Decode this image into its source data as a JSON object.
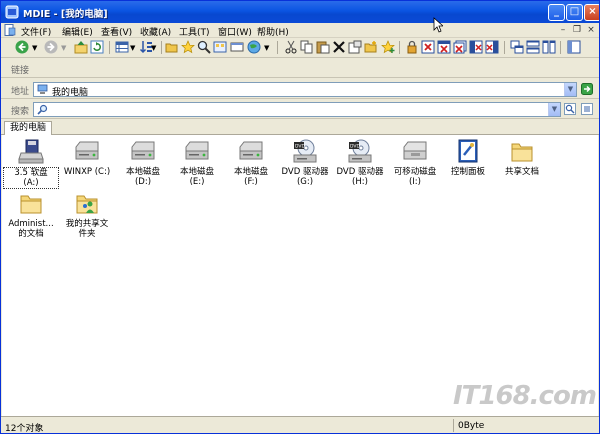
{
  "window": {
    "title": "MDIE - [我的电脑]"
  },
  "menubar": {
    "items": [
      "文件(F)",
      "编辑(E)",
      "查看(V)",
      "收藏(A)",
      "工具(T)",
      "窗口(W)",
      "帮助(H)"
    ]
  },
  "links_bar": {
    "label": "链接"
  },
  "address_bar": {
    "label": "地址",
    "value": "我的电脑"
  },
  "search_bar": {
    "label": "搜索",
    "value": ""
  },
  "tabs": [
    {
      "label": "我的电脑"
    }
  ],
  "items": [
    {
      "label": "3.5 软盘\n(A:)",
      "icon": "floppy-drive-icon"
    },
    {
      "label": "WINXP (C:)",
      "icon": "hard-disk-icon"
    },
    {
      "label": "本地磁盘\n(D:)",
      "icon": "hard-disk-icon"
    },
    {
      "label": "本地磁盘\n(E:)",
      "icon": "hard-disk-icon"
    },
    {
      "label": "本地磁盘\n(F:)",
      "icon": "hard-disk-icon"
    },
    {
      "label": "DVD 驱动器\n(G:)",
      "icon": "dvd-drive-icon"
    },
    {
      "label": "DVD 驱动器\n(H:)",
      "icon": "dvd-drive-icon"
    },
    {
      "label": "可移动磁盘\n(I:)",
      "icon": "removable-disk-icon"
    },
    {
      "label": "控制面板",
      "icon": "control-panel-icon"
    },
    {
      "label": "共享文档",
      "icon": "folder-icon"
    },
    {
      "label": "Administ...\n的文档",
      "icon": "folder-icon"
    },
    {
      "label": "我的共享文\n件夹",
      "icon": "shared-folder-icon"
    }
  ],
  "status": {
    "object_count": "12个对象",
    "size": "0Byte"
  },
  "watermark": "IT168.com",
  "colors": {
    "title_bar": "#0a54e2",
    "chrome": "#ece9d8",
    "address_border": "#7f9db9"
  }
}
